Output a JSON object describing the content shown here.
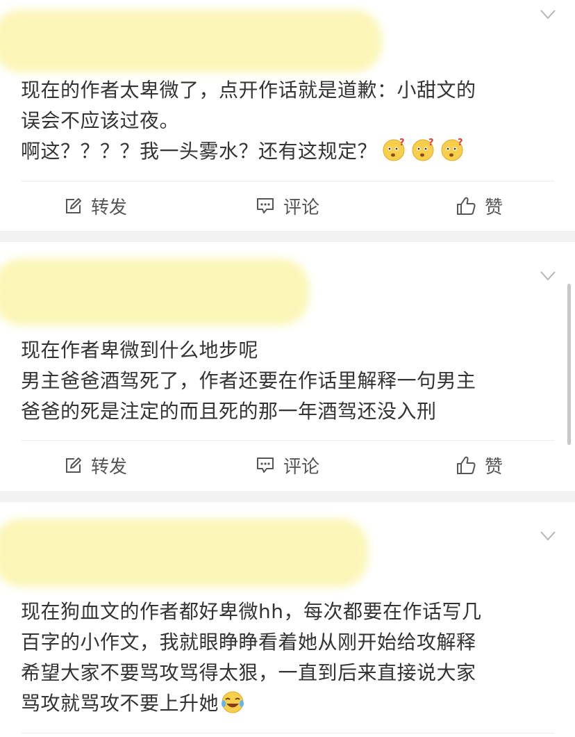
{
  "posts": [
    {
      "text": "现在的作者太卑微了，点开作话就是道歉：小甜文的\n误会不应该过夜。\n啊这？？？？我一头雾水？还有这规定？",
      "emoji": "thinking-face-icon",
      "actions": {
        "repost": "转发",
        "comment": "评论",
        "like": "赞"
      }
    },
    {
      "text": "现在作者卑微到什么地步呢\n男主爸爸酒驾死了，作者还要在作话里解释一句男主\n爸爸的死是注定的而且死的那一年酒驾还没入刑",
      "actions": {
        "repost": "转发",
        "comment": "评论",
        "like": "赞"
      }
    },
    {
      "text": "现在狗血文的作者都好卑微hh，每次都要在作话写几\n百字的小作文，我就眼睁睁看着她从刚开始给攻解释\n希望大家不要骂攻骂得太狠，一直到后来直接说大家\n骂攻就骂攻不要上升她",
      "emoji": "laughing-crying-face-icon"
    }
  ],
  "colors": {
    "background": "#f2f2f2",
    "card": "#ffffff",
    "redaction": "#fbf6b7",
    "text": "#333333",
    "action_text": "#555555"
  }
}
